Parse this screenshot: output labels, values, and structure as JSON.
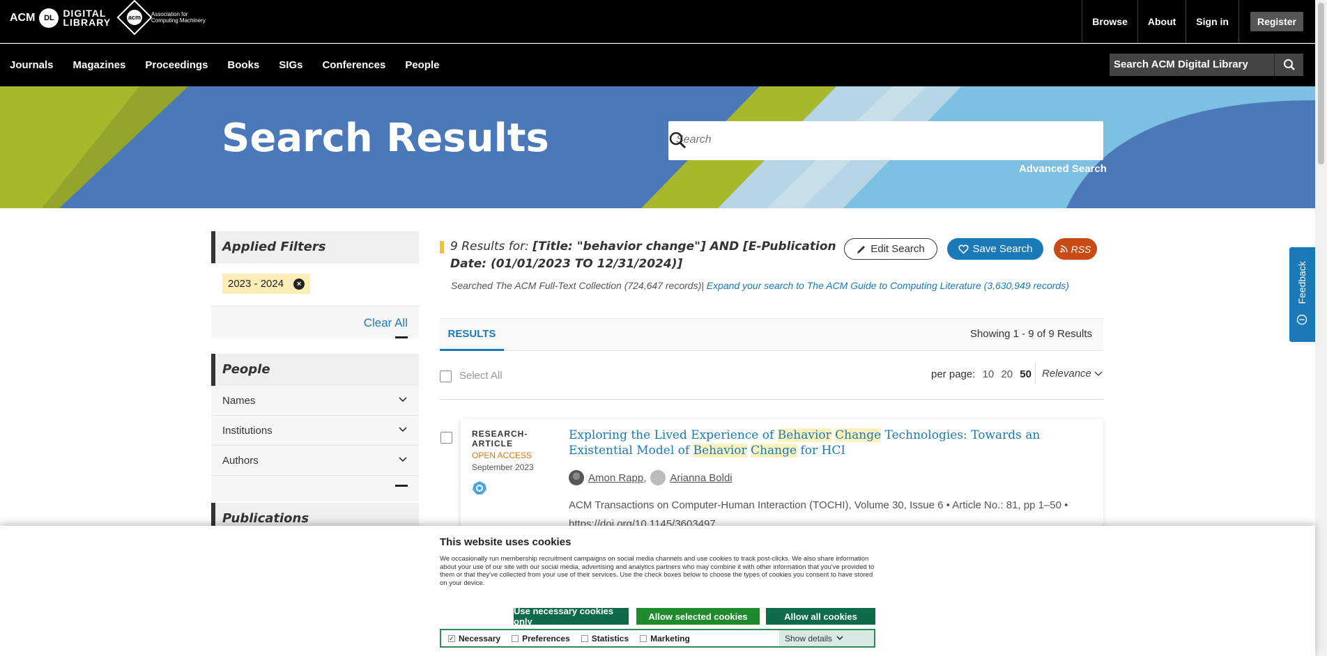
{
  "topbar": {
    "logo_acm": "ACM",
    "logo_dl": "DL",
    "logo_digital": "DIGITAL",
    "logo_library": "LIBRARY",
    "logo_assoc_1": "Association for",
    "logo_assoc_2": "Computing Machinery",
    "logo_acm_mark": "acm",
    "links": [
      "Browse",
      "About",
      "Sign in"
    ],
    "register": "Register"
  },
  "navbar": {
    "items": [
      "Journals",
      "Magazines",
      "Proceedings",
      "Books",
      "SIGs",
      "Conferences",
      "People"
    ],
    "search_placeholder": "Search ACM Digital Library"
  },
  "hero": {
    "title": "Search Results",
    "search_placeholder": "Search",
    "advanced": "Advanced Search"
  },
  "feedback": {
    "label": "Feedback"
  },
  "sidebar": {
    "applied_title": "Applied Filters",
    "chip": "2023 - 2024",
    "clear_all": "Clear All",
    "people_title": "People",
    "people_items": [
      "Names",
      "Institutions",
      "Authors"
    ],
    "publications_title": "Publications"
  },
  "results": {
    "count": "9",
    "results_for": "Results for:",
    "query": "[Title: \"behavior change\"] AND [E-Publication Date: (01/01/2023 TO 12/31/2024)]",
    "edit": "Edit Search",
    "save": "Save Search",
    "rss": "RSS",
    "searched": "Searched The ACM Full-Text Collection (724,647 records)|",
    "expand": "Expand your search to The ACM Guide to Computing Literature (3,630,949 records)",
    "tab": "RESULTS",
    "showing": "Showing 1 - 9  of 9 Results",
    "select_all": "Select All",
    "per_page_label": "per page:",
    "per_page_options": [
      "10",
      "20",
      "50"
    ],
    "sort": "Relevance"
  },
  "first_result": {
    "type": "RESEARCH-ARTICLE",
    "access": "OPEN ACCESS",
    "date": "September 2023",
    "title_parts": [
      "Exploring the Lived Experience of ",
      "Behavior",
      " ",
      "Change",
      " Technologies: Towards an Existential Model of ",
      "Behavior",
      " ",
      "Change",
      " for HCI"
    ],
    "authors": [
      "Amon Rapp,",
      "Arianna Boldi"
    ],
    "source": "ACM Transactions on Computer-Human Interaction (TOCHI), Volume 30, Issue 6 • Article No.: 81, pp 1–50 • https://doi.org/10.1145/3603497"
  },
  "cookie": {
    "title": "This website uses cookies",
    "text": "We occasionally run membership recruitment campaigns on social media channels and use cookies to track post-clicks. We also share information about your use of our site with our social media, advertising and analytics partners who may combine it with other information that you've provided to them or that they've collected from your use of their services. Use the check boxes below to choose the types of cookies you consent to have stored on your device.",
    "btn_necessary": "Use necessary cookies only",
    "btn_selected": "Allow selected cookies",
    "btn_all": "Allow all cookies",
    "options": [
      "Necessary",
      "Preferences",
      "Statistics",
      "Marketing"
    ],
    "show_details": "Show details"
  },
  "colors": {
    "accent": "#1a7ab8",
    "hero_blue": "#4a78b9",
    "hero_green": "#a8b82c",
    "oa_orange": "#d07a13",
    "rss": "#c84b16",
    "cookie_green": "#0e6b47"
  }
}
